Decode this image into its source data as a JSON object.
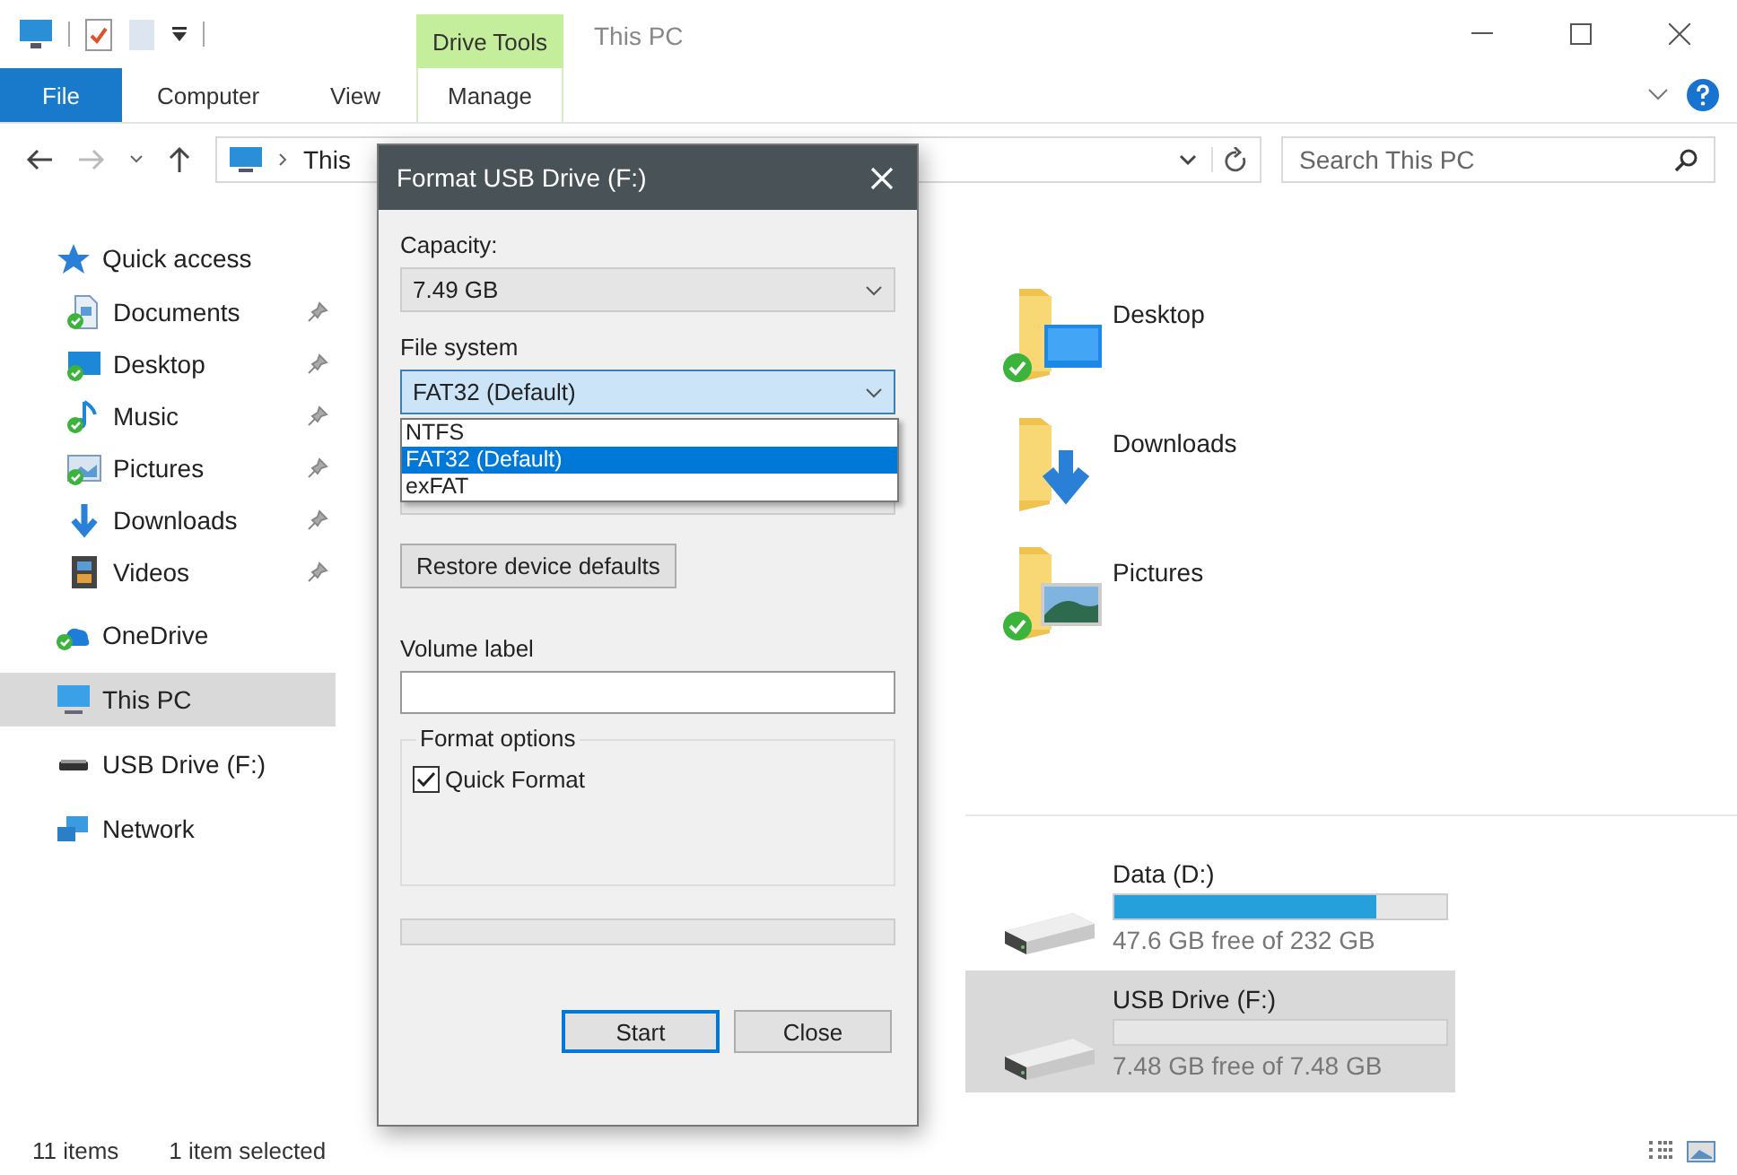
{
  "ribbon": {
    "context_group": "Drive Tools",
    "title": "This PC",
    "tabs": [
      {
        "label": "File",
        "kind": "file"
      },
      {
        "label": "Computer",
        "kind": "normal"
      },
      {
        "label": "View",
        "kind": "normal"
      },
      {
        "label": "Manage",
        "kind": "contextual"
      }
    ]
  },
  "address_bar": {
    "crumb": "This"
  },
  "search": {
    "placeholder": "Search This PC"
  },
  "sidebar": {
    "items": [
      {
        "label": "Quick access",
        "kind": "star",
        "synced": false,
        "selected": false,
        "children": [
          {
            "label": "Documents",
            "kind": "documents",
            "synced": true,
            "pinned": true,
            "selected": false
          },
          {
            "label": "Desktop",
            "kind": "desktop",
            "synced": true,
            "pinned": true,
            "selected": false
          },
          {
            "label": "Music",
            "kind": "music",
            "synced": true,
            "pinned": true,
            "selected": false
          },
          {
            "label": "Pictures",
            "kind": "pictures",
            "synced": true,
            "pinned": true,
            "selected": false
          },
          {
            "label": "Downloads",
            "kind": "downloads",
            "synced": false,
            "pinned": true,
            "selected": false
          },
          {
            "label": "Videos",
            "kind": "videos",
            "synced": false,
            "pinned": true,
            "selected": false
          }
        ]
      },
      {
        "label": "OneDrive",
        "kind": "onedrive",
        "synced": true,
        "selected": false
      },
      {
        "label": "This PC",
        "kind": "pc",
        "synced": false,
        "selected": true
      },
      {
        "label": "USB Drive (F:)",
        "kind": "usb",
        "synced": false,
        "selected": false
      },
      {
        "label": "Network",
        "kind": "network",
        "synced": false,
        "selected": false
      }
    ]
  },
  "folders": [
    {
      "name": "Desktop",
      "kind": "desktop",
      "synced": true
    },
    {
      "name": "Downloads",
      "kind": "downloads",
      "synced": false
    },
    {
      "name": "Pictures",
      "kind": "pictures",
      "synced": true
    }
  ],
  "drives": [
    {
      "name": "Data (D:)",
      "level": 0.79,
      "free": "47.6 GB free of 232 GB",
      "selected": false
    },
    {
      "name": "USB Drive (F:)",
      "level": 0,
      "free": "7.48 GB free of 7.48 GB",
      "selected": true
    }
  ],
  "status_bar": {
    "item_count": "11 items",
    "selection": "1 item selected"
  },
  "dialog": {
    "title": "Format USB Drive (F:)",
    "capacity_label": "Capacity:",
    "capacity": "7.49 GB",
    "file_system_label": "File system",
    "file_system": "FAT32 (Default)",
    "file_system_options": [
      {
        "label": "NTFS",
        "selected": false
      },
      {
        "label": "FAT32 (Default)",
        "selected": true
      },
      {
        "label": "exFAT",
        "selected": false
      }
    ],
    "restore_button": "Restore device defaults",
    "volume_label_label": "Volume label",
    "format_options_title": "Format options",
    "quick_format": {
      "label": "Quick Format",
      "checked": true
    },
    "progress": {
      "level": 0
    },
    "buttons": [
      {
        "label": "Start",
        "default": true
      },
      {
        "label": "Close",
        "default": false
      }
    ]
  }
}
